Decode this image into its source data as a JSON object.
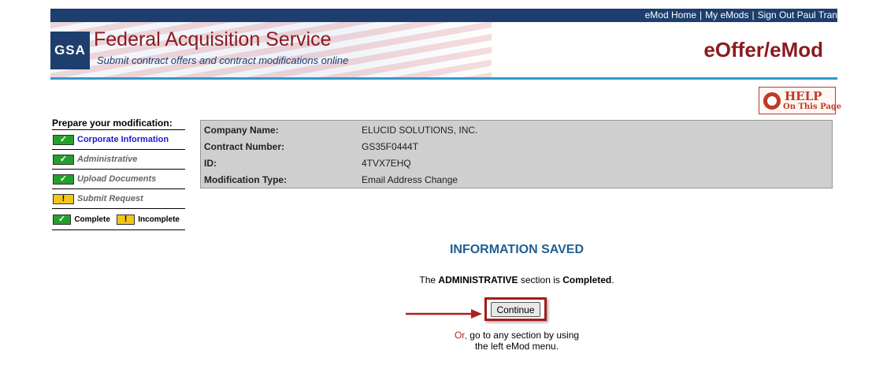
{
  "header": {
    "links": [
      "eMod Home",
      "My eMods",
      "Sign Out Paul Tran"
    ],
    "logo_text": "GSA",
    "title": "Federal Acquisition Service",
    "subtitle": "Submit contract offers and contract modifications online",
    "app_name": "eOffer/eMod",
    "help": {
      "line1": "HELP",
      "line2": "On This Page"
    }
  },
  "menu": {
    "heading": "Prepare your modification:",
    "items": [
      {
        "label": "Corporate Information",
        "status": "complete",
        "active": true
      },
      {
        "label": "Administrative",
        "status": "complete",
        "active": false
      },
      {
        "label": "Upload Documents",
        "status": "complete",
        "active": false
      },
      {
        "label": "Submit Request",
        "status": "incomplete",
        "active": false
      }
    ],
    "legend": {
      "complete": "Complete",
      "incomplete": "Incomplete"
    }
  },
  "info": {
    "rows": [
      {
        "label": "Company Name:",
        "value": "ELUCID SOLUTIONS, INC."
      },
      {
        "label": "Contract Number:",
        "value": "GS35F0444T"
      },
      {
        "label": "ID:",
        "value": "4TVX7EHQ"
      },
      {
        "label": "Modification Type:",
        "value": "Email Address Change"
      }
    ]
  },
  "message": {
    "title": "INFORMATION SAVED",
    "text_pre": "The ",
    "section": "ADMINISTRATIVE",
    "text_mid": " section is ",
    "status": "Completed",
    "text_post": ".",
    "continue_label": "Continue",
    "or_label": "Or,",
    "hint_line1": " go to any section by using",
    "hint_line2": "the left eMod menu."
  },
  "icons": {
    "complete": "checkmark-icon",
    "incomplete": "exclamation-icon",
    "help": "life-ring-icon",
    "arrow": "arrow-right-icon"
  },
  "colors": {
    "brand_navy": "#1d3e6e",
    "brand_red": "#8b1a1f",
    "accent_blue": "#3399cc",
    "complete_green": "#22a02a",
    "incomplete_yellow": "#f4c51a"
  }
}
